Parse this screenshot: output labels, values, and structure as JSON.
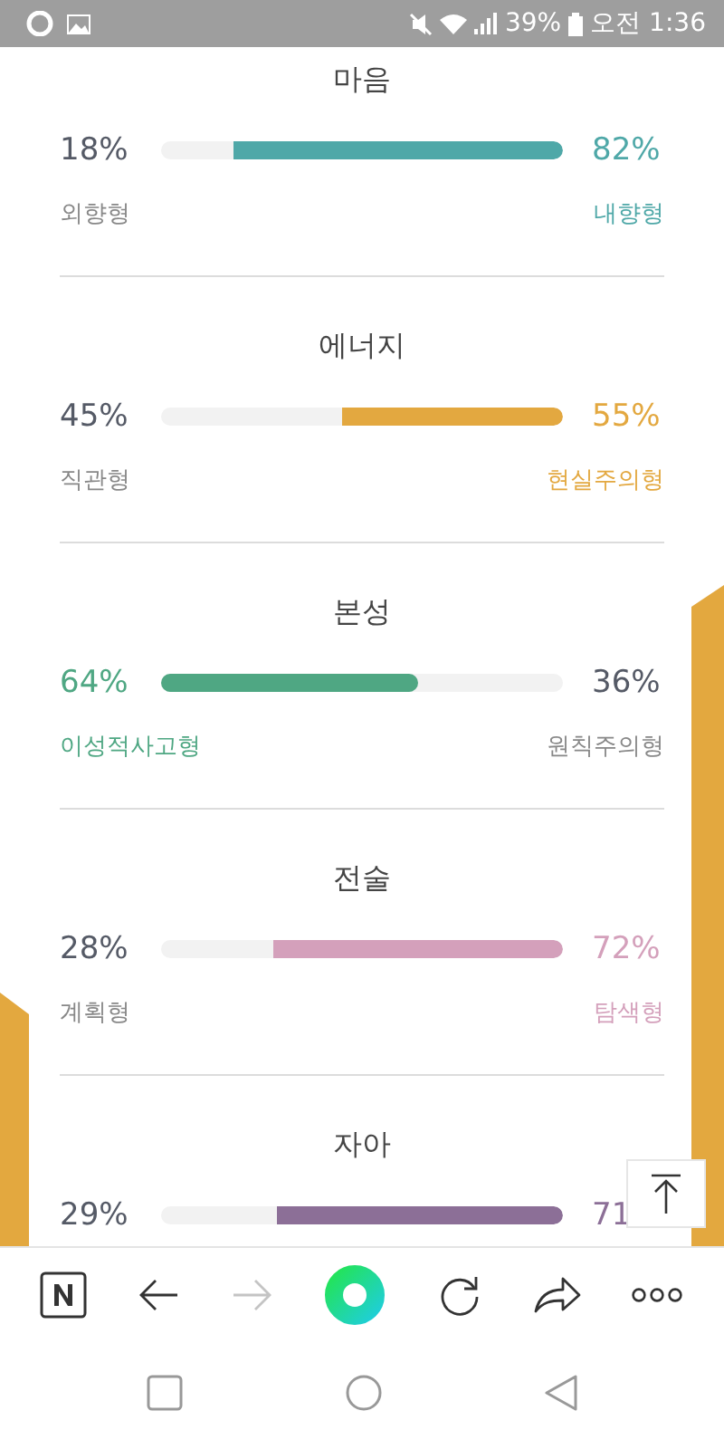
{
  "status_bar": {
    "battery": "39%",
    "time": "오전 1:36"
  },
  "traits": [
    {
      "title": "마음",
      "left_percent": "18%",
      "right_percent": "82%",
      "left_label": "외향형",
      "right_label": "내향형",
      "kind": "right",
      "level": 0.82,
      "color": "#4fa8a8"
    },
    {
      "title": "에너지",
      "left_percent": "45%",
      "right_percent": "55%",
      "left_label": "직관형",
      "right_label": "현실주의형",
      "kind": "right",
      "level": 0.55,
      "color": "#e3a840"
    },
    {
      "title": "본성",
      "left_percent": "64%",
      "right_percent": "36%",
      "left_label": "이성적사고형",
      "right_label": "원칙주의형",
      "kind": "left",
      "level": 0.64,
      "color": "#4fa783"
    },
    {
      "title": "전술",
      "left_percent": "28%",
      "right_percent": "72%",
      "left_label": "계획형",
      "right_label": "탐색형",
      "kind": "right",
      "level": 0.72,
      "color": "#d4a0bb"
    },
    {
      "title": "자아",
      "left_percent": "29%",
      "right_percent": "71",
      "kind": "right",
      "level": 0.71,
      "color": "#8c6f97"
    }
  ],
  "browser_toolbar": {
    "forward_disabled": true
  }
}
